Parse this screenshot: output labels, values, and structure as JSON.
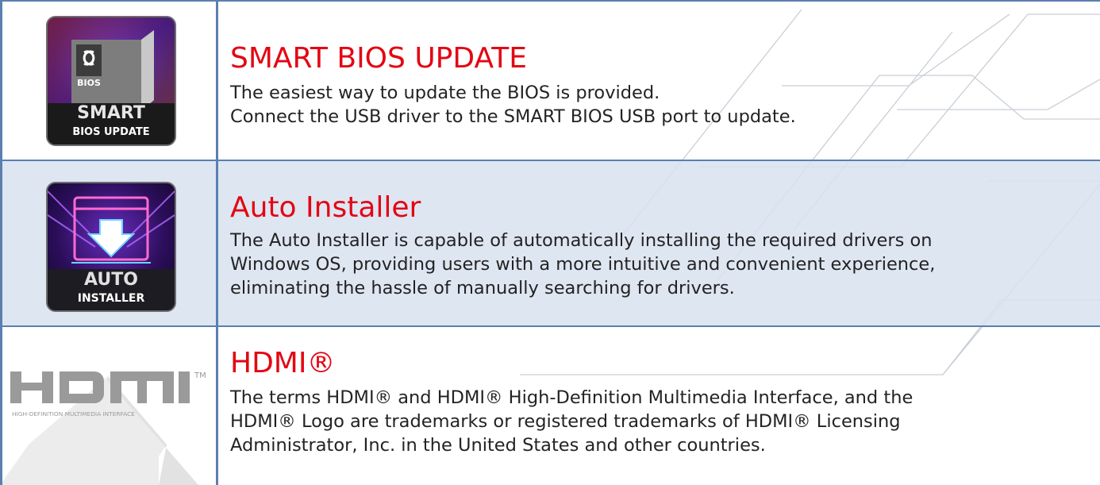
{
  "features": [
    {
      "title": "SMART BIOS UPDATE",
      "lines": [
        "The easiest way to update the BIOS is provided.",
        "Connect the USB driver to the SMART BIOS USB port to update."
      ],
      "icon": {
        "name": "smart-bios-update-icon",
        "chip_label": "BIOS",
        "big_text": "SMART",
        "small_text": "BIOS UPDATE"
      }
    },
    {
      "title": "Auto Installer",
      "lines": [
        "The Auto Installer is capable of automatically installing the required drivers on",
        "Windows OS, providing users with a more intuitive and convenient experience,",
        "eliminating the hassle of manually searching for drivers."
      ],
      "icon": {
        "name": "auto-installer-icon",
        "big_text": "AUTO",
        "small_text": "INSTALLER"
      }
    },
    {
      "title": "HDMI®",
      "lines": [
        "The terms HDMI® and HDMI® High-Definition Multimedia Interface, and the",
        "HDMI® Logo are trademarks or registered trademarks of HDMI® Licensing",
        "Administrator, Inc. in the United States and other countries."
      ],
      "icon": {
        "name": "hdmi-logo",
        "logo_text": "HDMI",
        "tm": "TM",
        "tagline": "HIGH-DEFINITION MULTIMEDIA INTERFACE"
      }
    }
  ],
  "colors": {
    "title_red": "#e30613",
    "grid_blue": "#5b7fb0",
    "row_tint": "#d8e2f0",
    "text": "#232323"
  }
}
